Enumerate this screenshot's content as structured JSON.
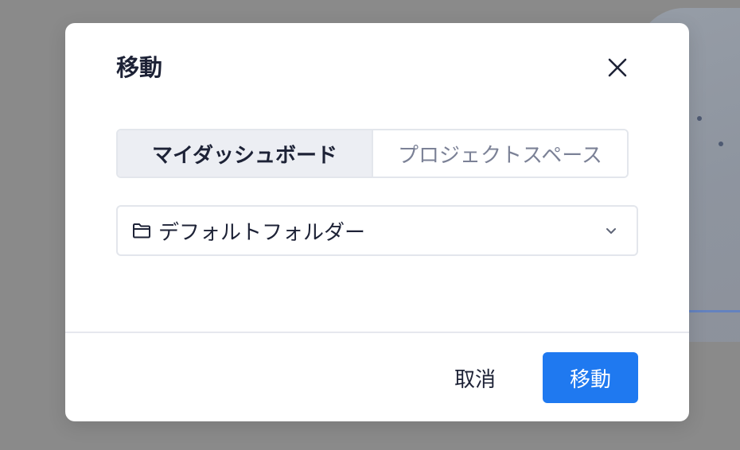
{
  "dialog": {
    "title": "移動",
    "close_icon": "close-icon"
  },
  "tabs": [
    {
      "label": "マイダッシュボード",
      "active": true
    },
    {
      "label": "プロジェクトスペース",
      "active": false
    }
  ],
  "folder_select": {
    "icon": "folder-icon",
    "value": "デフォルトフォルダー",
    "chevron_icon": "chevron-down-icon"
  },
  "footer": {
    "cancel_label": "取消",
    "confirm_label": "移動"
  },
  "colors": {
    "primary": "#1f79f0",
    "text": "#1d2236",
    "muted_text": "#7b8196",
    "overlay": "#8a8a8a"
  }
}
